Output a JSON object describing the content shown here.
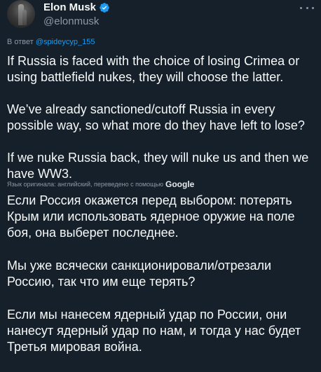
{
  "author": {
    "display_name": "Elon Musk",
    "handle": "@elonmusk",
    "verified": true
  },
  "reply_to": {
    "prefix": "В ответ",
    "mention": "@spideycyp_155"
  },
  "tweet": {
    "paragraphs": [
      "If Russia is faced with the choice of losing Crimea or using battlefield nukes, they will choose the latter.",
      "We’ve already sanctioned/cutoff Russia in every possible way, so what more do they have left to lose?",
      "If we nuke Russia back, they will nuke us and then we have WW3."
    ]
  },
  "translation": {
    "note": "Язык оригинала: английский, переведено с помощью",
    "provider": "Google",
    "paragraphs": [
      "Если Россия окажется перед выбором: потерять Крым или использовать ядерное оружие на поле боя, она выберет последнее.",
      "Мы уже всячески санкционировали/отрезали Россию, так что им еще терять?",
      "Если мы нанесем ядерный удар по России, они нанесут ядерный удар по нам, и тогда у нас будет Третья мировая война."
    ]
  },
  "colors": {
    "background": "#15202b",
    "text": "#f7f9f9",
    "secondary": "#8b98a5",
    "accent": "#1d9bf0"
  },
  "icons": {
    "verified": "verified-badge-icon",
    "more": "more-options-icon"
  }
}
